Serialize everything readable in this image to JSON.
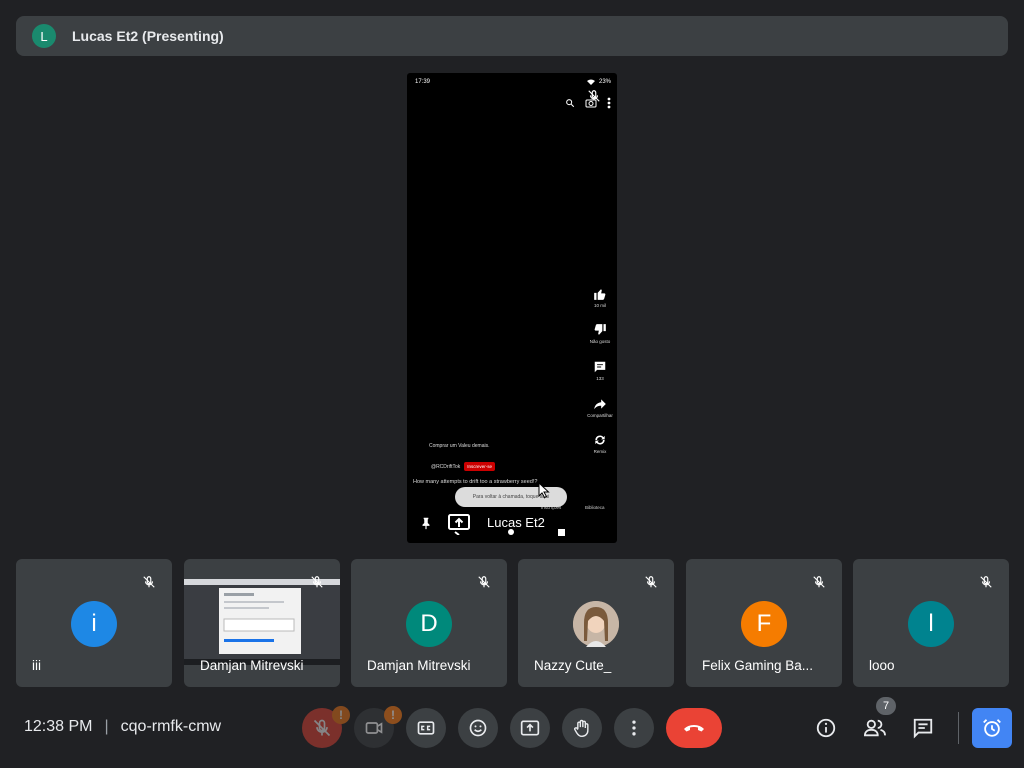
{
  "presenter": {
    "initial": "L",
    "title": "Lucas Et2 (Presenting)"
  },
  "stage": {
    "status_time": "17:39",
    "status_battery": "23%",
    "like_count": "10 mil",
    "dislike_label": "Não gosto",
    "comment_count": "133",
    "share_label": "Compartilhar",
    "remix_label": "Remix",
    "description": "Comprar um Valeu demais.",
    "handle": "@RCDriftTok",
    "subscribe_label": "Inscrever-se",
    "caption": "How many attempts to drift too a strawberry seed!?",
    "toast": "Para voltar à chamada, toque aqui",
    "nav_inscricoes": "Inscrições",
    "nav_biblioteca": "Biblioteca",
    "presenter_name": "Lucas Et2"
  },
  "participants": [
    {
      "name": "iii",
      "initial": "i",
      "color": "#1e88e5"
    },
    {
      "name": "Damjan Mitrevski",
      "initial": "",
      "color": ""
    },
    {
      "name": "Damjan Mitrevski",
      "initial": "D",
      "color": "#00897b"
    },
    {
      "name": "Nazzy Cute_",
      "initial": "",
      "color": ""
    },
    {
      "name": "Felix Gaming Ba...",
      "initial": "F",
      "color": "#f57c00"
    },
    {
      "name": "looo",
      "initial": "l",
      "color": "#00838f"
    }
  ],
  "meeting": {
    "time": "12:38 PM",
    "code": "cqo-rmfk-cmw"
  },
  "controls": {
    "mic_badge": "!",
    "cam_badge": "!"
  },
  "people_count": "7"
}
